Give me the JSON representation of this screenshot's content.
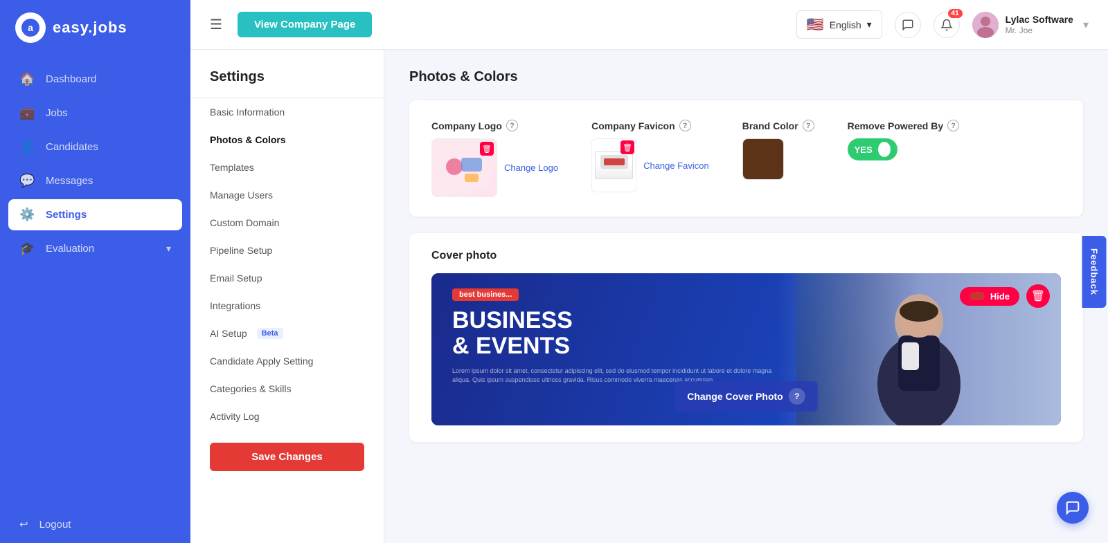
{
  "app": {
    "name": "easy.jobs",
    "logo_letter": "a"
  },
  "topbar": {
    "menu_icon": "☰",
    "view_company_btn": "View Company Page",
    "lang": {
      "label": "English",
      "flag": "🇺🇸",
      "chevron": "▾"
    },
    "notification_count": "41",
    "user": {
      "company": "Lylac Software",
      "role": "Mr. Joe",
      "chevron": "▾"
    }
  },
  "sidebar_nav": {
    "items": [
      {
        "id": "dashboard",
        "label": "Dashboard",
        "icon": "🏠"
      },
      {
        "id": "jobs",
        "label": "Jobs",
        "icon": "💼"
      },
      {
        "id": "candidates",
        "label": "Candidates",
        "icon": "👤"
      },
      {
        "id": "messages",
        "label": "Messages",
        "icon": "💬"
      },
      {
        "id": "settings",
        "label": "Settings",
        "icon": "⚙️"
      },
      {
        "id": "evaluation",
        "label": "Evaluation",
        "icon": "🎓"
      }
    ],
    "logout": "Logout"
  },
  "settings": {
    "title": "Settings",
    "nav_items": [
      {
        "id": "basic-information",
        "label": "Basic Information",
        "active": false
      },
      {
        "id": "photos-colors",
        "label": "Photos & Colors",
        "active": true
      },
      {
        "id": "templates",
        "label": "Templates",
        "active": false
      },
      {
        "id": "manage-users",
        "label": "Manage Users",
        "active": false
      },
      {
        "id": "custom-domain",
        "label": "Custom Domain",
        "active": false
      },
      {
        "id": "pipeline-setup",
        "label": "Pipeline Setup",
        "active": false
      },
      {
        "id": "email-setup",
        "label": "Email Setup",
        "active": false
      },
      {
        "id": "integrations",
        "label": "Integrations",
        "active": false
      },
      {
        "id": "ai-setup",
        "label": "AI Setup",
        "beta": true,
        "active": false
      },
      {
        "id": "candidate-apply-setting",
        "label": "Candidate Apply Setting",
        "active": false
      },
      {
        "id": "categories-skills",
        "label": "Categories & Skills",
        "active": false
      },
      {
        "id": "activity-log",
        "label": "Activity Log",
        "active": false
      }
    ],
    "save_btn": "Save Changes"
  },
  "photos_colors": {
    "section_title": "Photos & Colors",
    "company_logo": {
      "label": "Company Logo",
      "change_link": "Change Logo"
    },
    "company_favicon": {
      "label": "Company Favicon",
      "change_link": "Change Favicon"
    },
    "brand_color": {
      "label": "Brand Color",
      "color": "#5c3317"
    },
    "remove_powered_by": {
      "label": "Remove Powered By",
      "toggle_label": "YES"
    }
  },
  "cover_photo": {
    "section_title": "Cover photo",
    "change_btn": "Change Cover Photo",
    "hide_btn": "Hide",
    "tag": "best busines...",
    "heading_line1": "BUSINESS",
    "heading_line2": "& EVENTS",
    "lorem": "Lorem ipsum dolor sit amet, consectetur adipiscing elit, sed do eiusmod tempor incididunt ut labore et dolore magna aliqua. Quis ipsum suspendisse ultrices gravida. Risus commodo viverra maecenas accumsan."
  },
  "feedback_tab": "Feedback"
}
